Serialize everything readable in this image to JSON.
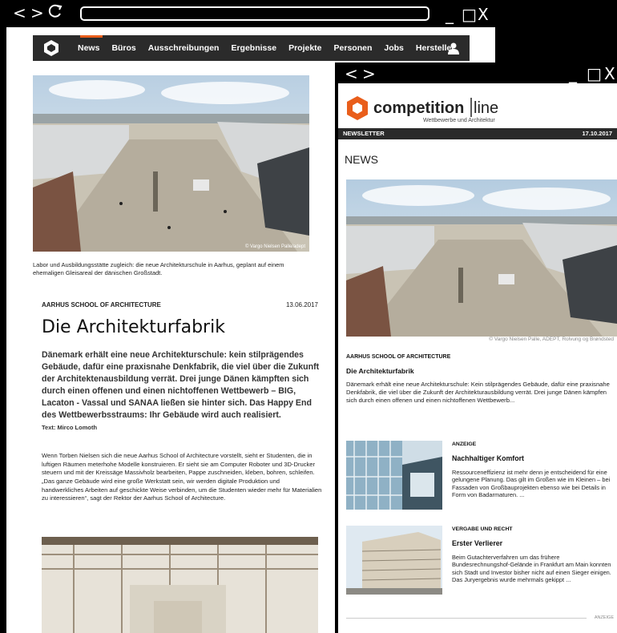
{
  "back_window": {
    "controls": {
      "back": "<",
      "forward": ">",
      "reload": "C",
      "minimize": "_",
      "maximize": "□",
      "close": "X"
    },
    "site_nav": {
      "items": [
        "News",
        "Büros",
        "Ausschreibungen",
        "Ergebnisse",
        "Projekte",
        "Personen",
        "Jobs",
        "Hersteller"
      ]
    },
    "article": {
      "image_credit": "© Vargo Nielsen Palle/adept",
      "caption": "Labor und Ausbildungsstätte zugleich: die neue Architekturschule in Aarhus, geplant auf einem ehemaligen Gleisareal der dänischen Großstadt.",
      "kicker": "AARHUS SCHOOL OF ARCHITECTURE",
      "date": "13.06.2017",
      "headline": "Die Architekturfabrik",
      "lead": "Dänemark erhält eine neue Architekturschule: kein stilprägendes Gebäude, dafür eine praxisnahe Denkfabrik, die viel über die Zukunft der Architektenausbildung verrät. Drei junge Dänen kämpften sich durch einen offenen und einen nichtoffenen Wettbewerb – BIG, Lacaton - Vassal und SANAA ließen sie hinter sich. Das Happy End des Wettbewerbsstraums: Ihr Gebäude wird auch realisiert.",
      "byline": "Text: Mirco Lomoth",
      "body": "Wenn Torben Nielsen sich die neue Aarhus School of Architecture vorstellt, sieht er Studenten, die in luftigen Räumen meterhohe Modelle konstruieren. Er sieht sie am Computer Roboter und 3D-Drucker steuern und mit der Kreissäge Massivholz bearbeiten, Pappe zuschneiden, kleben, bohren, schleifen. „Das ganze Gebäude wird eine große Werkstatt sein, wir werden digitale Produktion und handwerkliches Arbeiten auf geschickte Weise verbinden, um die Studenten wieder mehr für Materialien zu interessieren“, sagt der Rektor der Aarhus School of Architecture."
    }
  },
  "front_window": {
    "controls": {
      "back": "<",
      "forward": ">",
      "minimize": "_",
      "maximize": "□",
      "close": "X"
    },
    "logo": {
      "word": "competition",
      "word2": "line",
      "tagline": "Wettbewerbe und Architektur"
    },
    "bar": {
      "left": "NEWSLETTER",
      "right": "17.10.2017"
    },
    "section_title": "NEWS",
    "image_credit": "© Vargo Nielsen Palle, ADEPT, Rolvung og Brøndsted",
    "top_story": {
      "kicker": "AARHUS SCHOOL OF ARCHITECTURE",
      "title": "Die Architekturfabrik",
      "teaser": "Dänemark erhält eine neue Architekturschule: Kein stilprägendes Gebäude, dafür eine praxisnahe Denkfabrik, die viel über die Zukunft der Architekturausbildung verrät. Drei junge Dänen kämpfen sich durch einen offenen und einen nichtoffenen Wettbewerb..."
    },
    "items": [
      {
        "kicker": "ANZEIGE",
        "title": "Nachhaltiger Komfort",
        "text": "Ressourceneffizienz ist mehr denn je entscheidend für eine gelungene Planung. Das gilt im Großen wie im Kleinen – bei Fassaden von Großbauprojekten ebenso wie bei Details in Form von Badarmaturen. ..."
      },
      {
        "kicker": "VERGABE UND RECHT",
        "title": "Erster Verlierer",
        "text": "Beim Gutachterverfahren um das frühere Bundesrechnungshof-Gelände in Frankfurt am Main konnten sich Stadt und Investor bisher nicht auf einen Sieger einigen. Das Juryergebnis wurde mehrmals gekippt ..."
      }
    ],
    "footer_label": "ANZEIGE"
  },
  "colors": {
    "accent": "#e95e1b",
    "nav_bg": "#2b2b2b",
    "chrome": "#000000"
  }
}
